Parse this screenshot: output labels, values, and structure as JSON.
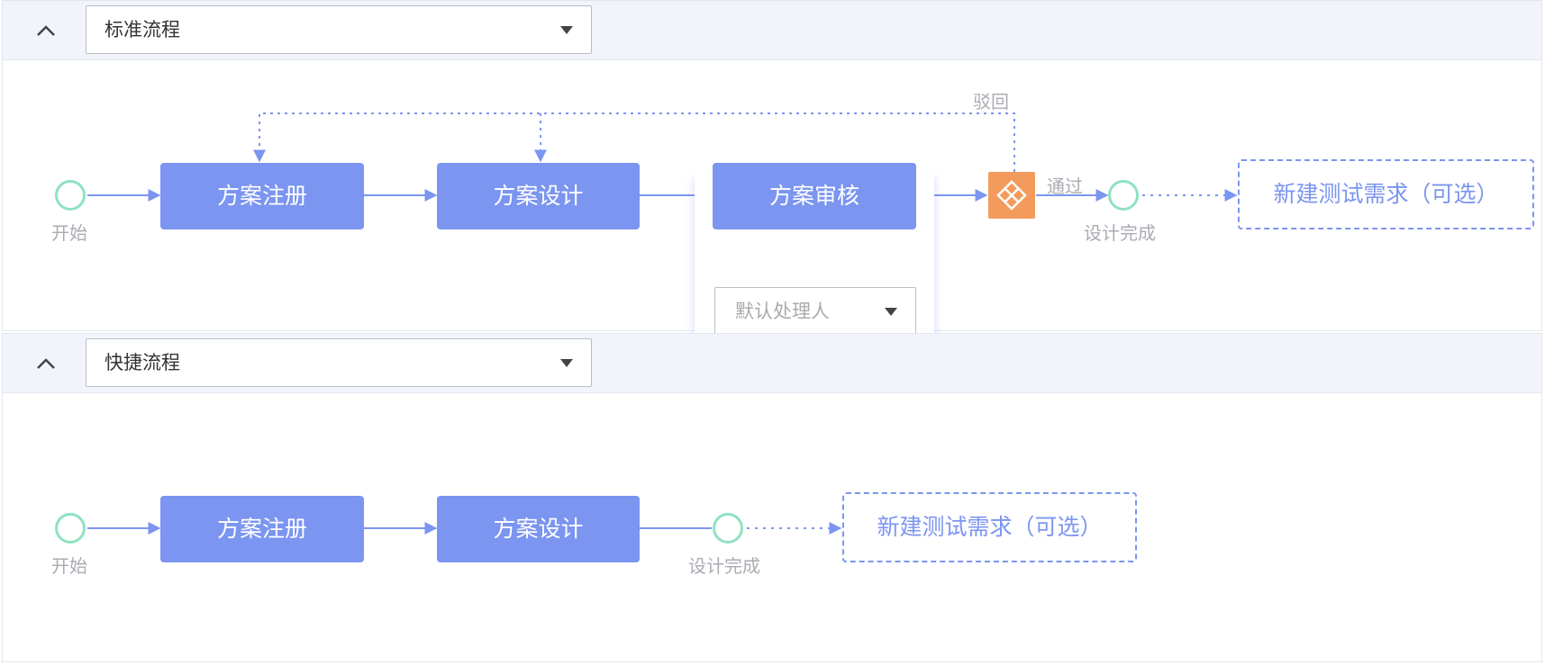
{
  "colors": {
    "header_bg": "#f1f4fb",
    "node_fill": "#7b95f0",
    "connector": "#7b95f0",
    "event_circle": "#8fe2c1",
    "gateway_fill": "#f39b5c",
    "label_gray": "#a9acb3"
  },
  "standard_panel": {
    "collapse_icon": "chevron-up-icon",
    "flow_select": {
      "value": "标准流程",
      "icon": "caret-down-icon"
    },
    "start_label": "开始",
    "nodes": [
      "方案注册",
      "方案设计",
      "方案审核"
    ],
    "assignee_select": {
      "value": "默认处理人",
      "icon": "caret-down-icon"
    },
    "gateway_icon": "gateway-diamond-icon",
    "reject_label": "驳回",
    "pass_label": "通过",
    "end_label": "设计完成",
    "optional_node": "新建测试需求（可选）"
  },
  "quick_panel": {
    "collapse_icon": "chevron-up-icon",
    "flow_select": {
      "value": "快捷流程",
      "icon": "caret-down-icon"
    },
    "start_label": "开始",
    "nodes": [
      "方案注册",
      "方案设计"
    ],
    "end_label": "设计完成",
    "optional_node": "新建测试需求（可选）"
  }
}
